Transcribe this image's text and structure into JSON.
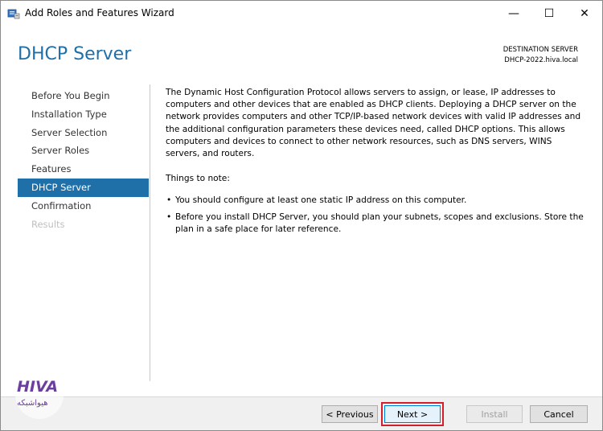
{
  "window": {
    "title": "Add Roles and Features Wizard",
    "controls": {
      "minimize": "—",
      "maximize": "☐",
      "close": "✕"
    }
  },
  "header": {
    "page_title": "DHCP Server",
    "destination_label": "DESTINATION SERVER",
    "destination_value": "DHCP-2022.hiva.local"
  },
  "nav": {
    "items": [
      {
        "label": "Before You Begin",
        "state": "normal"
      },
      {
        "label": "Installation Type",
        "state": "normal"
      },
      {
        "label": "Server Selection",
        "state": "normal"
      },
      {
        "label": "Server Roles",
        "state": "normal"
      },
      {
        "label": "Features",
        "state": "normal"
      },
      {
        "label": "DHCP Server",
        "state": "active"
      },
      {
        "label": "Confirmation",
        "state": "normal"
      },
      {
        "label": "Results",
        "state": "disabled"
      }
    ]
  },
  "content": {
    "description": "The Dynamic Host Configuration Protocol allows servers to assign, or lease, IP addresses to computers and other devices that are enabled as DHCP clients. Deploying a DHCP server on the network provides computers and other TCP/IP-based network devices with valid IP addresses and the additional configuration parameters these devices need, called DHCP options. This allows computers and devices to connect to other network resources, such as DNS servers, WINS servers, and routers.",
    "notes_heading": "Things to note:",
    "notes": [
      "You should configure at least one static IP address on this computer.",
      "Before you install DHCP Server, you should plan your subnets, scopes and exclusions. Store the plan in a safe place for later reference."
    ]
  },
  "footer": {
    "previous_label": "< Previous",
    "next_label": "Next >",
    "install_label": "Install",
    "cancel_label": "Cancel"
  },
  "watermark": {
    "brand": "HIVA",
    "tagline": "هیواشبکه",
    "color": "#6b3fa0"
  },
  "colors": {
    "accent": "#1f6fa8",
    "highlight": "#d21f2b"
  }
}
